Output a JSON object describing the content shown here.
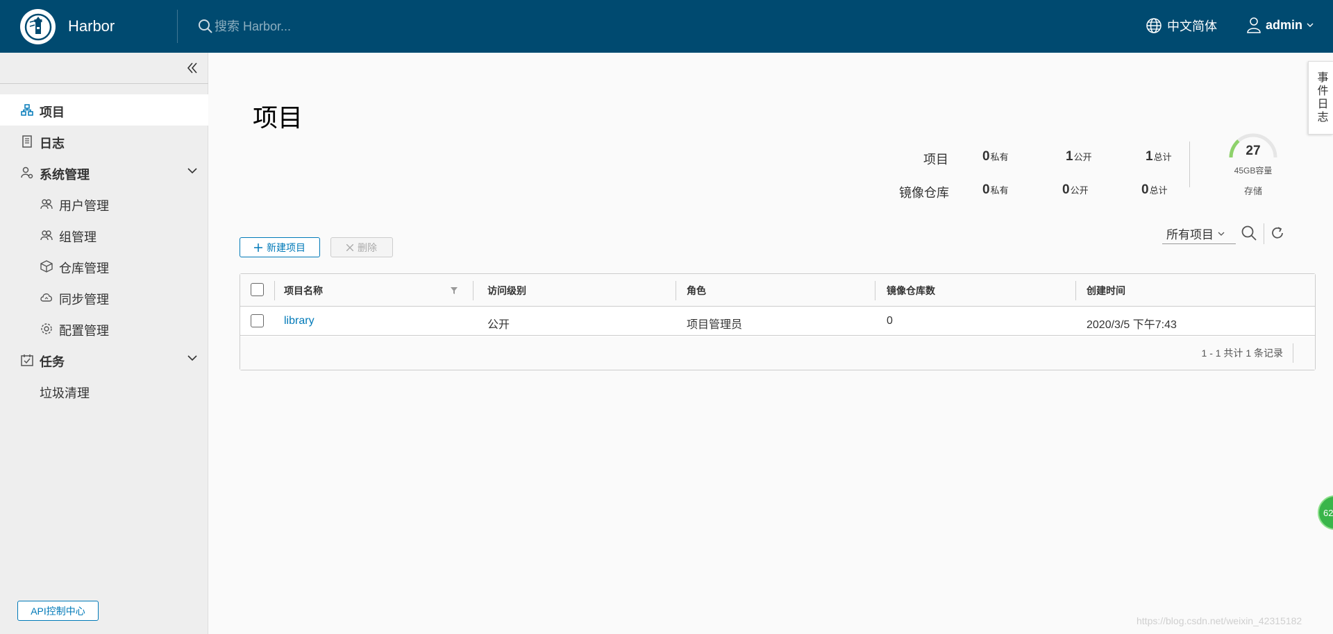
{
  "header": {
    "app_title": "Harbor",
    "search_placeholder": "搜索 Harbor...",
    "language": "中文简体",
    "user": "admin"
  },
  "sidebar": {
    "items": [
      {
        "label": "项目",
        "icon": "projects-icon",
        "active": true
      },
      {
        "label": "日志",
        "icon": "logs-icon"
      },
      {
        "label": "系统管理",
        "icon": "admin-icon",
        "expandable": true
      },
      {
        "label": "用户管理",
        "icon": "users-icon"
      },
      {
        "label": "组管理",
        "icon": "groups-icon"
      },
      {
        "label": "仓库管理",
        "icon": "registry-icon"
      },
      {
        "label": "同步管理",
        "icon": "replication-icon"
      },
      {
        "label": "配置管理",
        "icon": "config-icon"
      },
      {
        "label": "任务",
        "icon": "tasks-icon",
        "expandable": true
      },
      {
        "label": "垃圾清理"
      }
    ],
    "api_center": "API控制中心"
  },
  "main": {
    "title": "项目",
    "stats": {
      "projects_label": "项目",
      "repos_label": "镜像仓库",
      "projects": {
        "private": "0",
        "public": "1",
        "total": "1"
      },
      "repos": {
        "private": "0",
        "public": "0",
        "total": "0"
      },
      "private_label": "私有",
      "public_label": "公开",
      "total_label": "总计"
    },
    "storage": {
      "value": "27",
      "capacity": "45GB容量",
      "label": "存储",
      "used_fraction": 0.27
    },
    "toolbar": {
      "new_project": "新建项目",
      "delete": "删除",
      "filter": "所有项目"
    },
    "table": {
      "columns": [
        "项目名称",
        "访问级别",
        "角色",
        "镜像仓库数",
        "创建时间"
      ],
      "rows": [
        {
          "name": "library",
          "access": "公开",
          "role": "项目管理员",
          "repo_count": "0",
          "created": "2020/3/5 下午7:43"
        }
      ],
      "footer": "1 - 1 共计 1 条记录"
    }
  },
  "side_widgets": {
    "event_log": "事件日志",
    "badge": "62"
  },
  "watermark": "https://blog.csdn.net/weixin_42315182",
  "colors": {
    "header_bg": "#004a70",
    "accent": "#0079b8",
    "sidebar_bg": "#eeeeee",
    "gauge_green": "#8ed26b"
  }
}
